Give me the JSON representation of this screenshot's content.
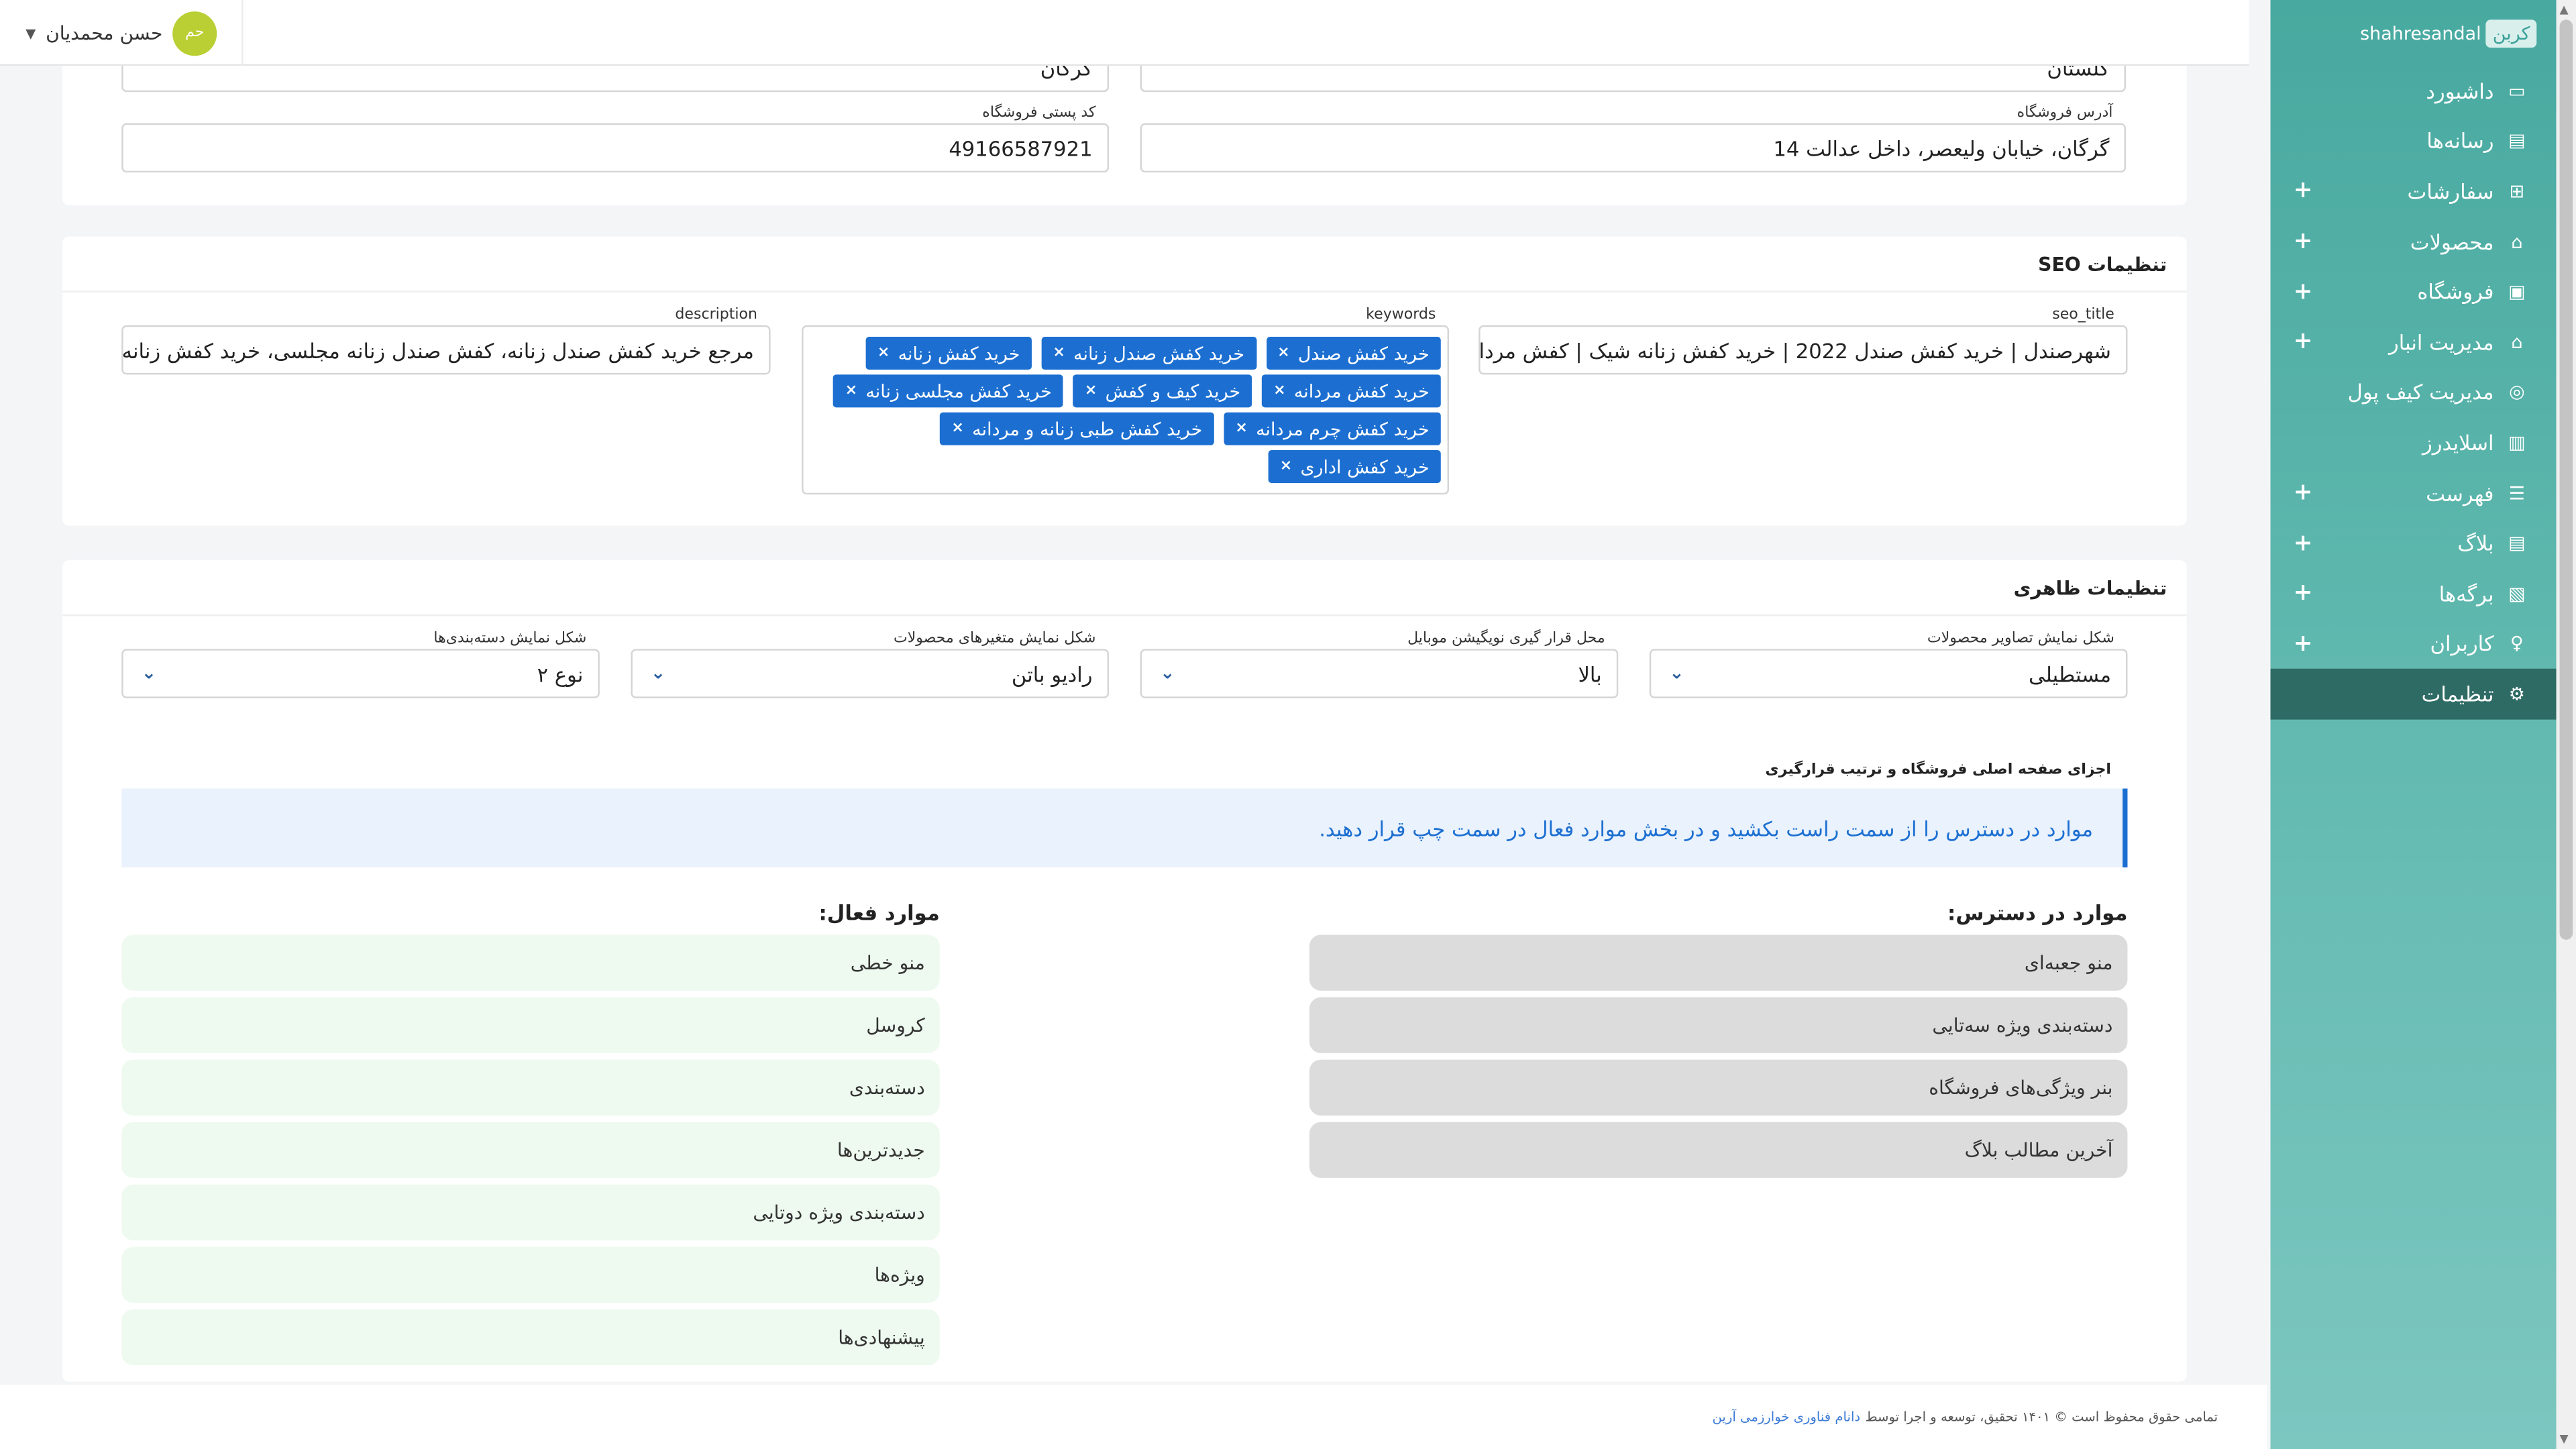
{
  "brand": {
    "badge": "کربن",
    "name": "shahresandal"
  },
  "user": {
    "avatar_initials": "حم",
    "name": "حسن محمدیان"
  },
  "sidebar": {
    "items": [
      {
        "label": "داشبورد",
        "icon": "monitor-icon",
        "plus": false
      },
      {
        "label": "رسانه‌ها",
        "icon": "images-icon",
        "plus": false
      },
      {
        "label": "سفارشات",
        "icon": "cart-icon",
        "plus": true
      },
      {
        "label": "محصولات",
        "icon": "basket-icon",
        "plus": true
      },
      {
        "label": "فروشگاه",
        "icon": "store-icon",
        "plus": true
      },
      {
        "label": "مدیریت انبار",
        "icon": "warehouse-icon",
        "plus": true
      },
      {
        "label": "مدیریت کیف پول",
        "icon": "wallet-icon",
        "plus": false
      },
      {
        "label": "اسلایدرز",
        "icon": "slider-icon",
        "plus": false
      },
      {
        "label": "فهرست",
        "icon": "list-icon",
        "plus": true
      },
      {
        "label": "بلاگ",
        "icon": "blog-icon",
        "plus": true
      },
      {
        "label": "برگه‌ها",
        "icon": "pages-icon",
        "plus": true
      },
      {
        "label": "کاربران",
        "icon": "user-icon",
        "plus": true
      },
      {
        "label": "تنظیمات",
        "icon": "gear-icon",
        "plus": false,
        "active": true
      }
    ]
  },
  "store": {
    "province_value": "گلستان",
    "city_value": "گرگان",
    "address_label": "آدرس فروشگاه",
    "address_value": "گرگان، خیابان ولیعصر، داخل عدالت 14",
    "postal_label": "کد پستی فروشگاه",
    "postal_value": "49166587921"
  },
  "seo": {
    "heading": "تنظیمات SEO",
    "title_label": "seo_title",
    "title_value": "شهرصندل | خرید کفش صندل 2022 | خرید کفش زنانه شیک | کفش مردانه جد",
    "keywords_label": "keywords",
    "keywords": [
      "خرید کفش صندل",
      "خرید کفش صندل زنانه",
      "خرید کفش زنانه",
      "خرید کفش مردانه",
      "خرید کیف و کفش",
      "خرید کفش مجلسی زنانه",
      "خرید کفش چرم مردانه",
      "خرید کفش طبی زنانه و مردانه",
      "خرید کفش اداری"
    ],
    "description_label": "description",
    "description_value": "مرجع خرید کفش صندل زنانه، کفش صندل زنانه مجلسی، خرید کفش زنانه شیک"
  },
  "appearance": {
    "heading": "تنظیمات ظاهری",
    "selects": [
      {
        "label": "شکل نمایش تصاویر محصولات",
        "value": "مستطیلی"
      },
      {
        "label": "محل قرار گیری نویگیشن موبایل",
        "value": "بالا"
      },
      {
        "label": "شکل نمایش متغیرهای محصولات",
        "value": "رادیو باتن"
      },
      {
        "label": "شکل نمایش دسته‌بندی‌ها",
        "value": "نوع ۲"
      }
    ],
    "homepage_label": "اجزای صفحه اصلی فروشگاه و ترتیب قرارگیری",
    "info": "موارد در دسترس را از سمت راست بکشید و در بخش موارد فعال در سمت چپ قرار دهید.",
    "available_title": "موارد در دسترس:",
    "available": [
      "منو جعبه‌ای",
      "دسته‌بندی ویژه سه‌تایی",
      "بنر ویژگی‌های فروشگاه",
      "آخرین مطالب بلاگ"
    ],
    "active_title": "موارد فعال:",
    "active": [
      "منو خطی",
      "کروسل",
      "دسته‌بندی",
      "جدیدترین‌ها",
      "دسته‌بندی ویژه دوتایی",
      "ویژه‌ها",
      "پیشنهادی‌ها"
    ]
  },
  "footer": {
    "text": "تمامی حقوق محفوظ است © ۱۴۰۱ تحقیق، توسعه و اجرا توسط",
    "link": "دانام فناوری خوارزمی آرین"
  },
  "colors": {
    "sidebar": "#48a9a0",
    "accent": "#1c6fd1",
    "active_nav": "#2e6b65"
  }
}
